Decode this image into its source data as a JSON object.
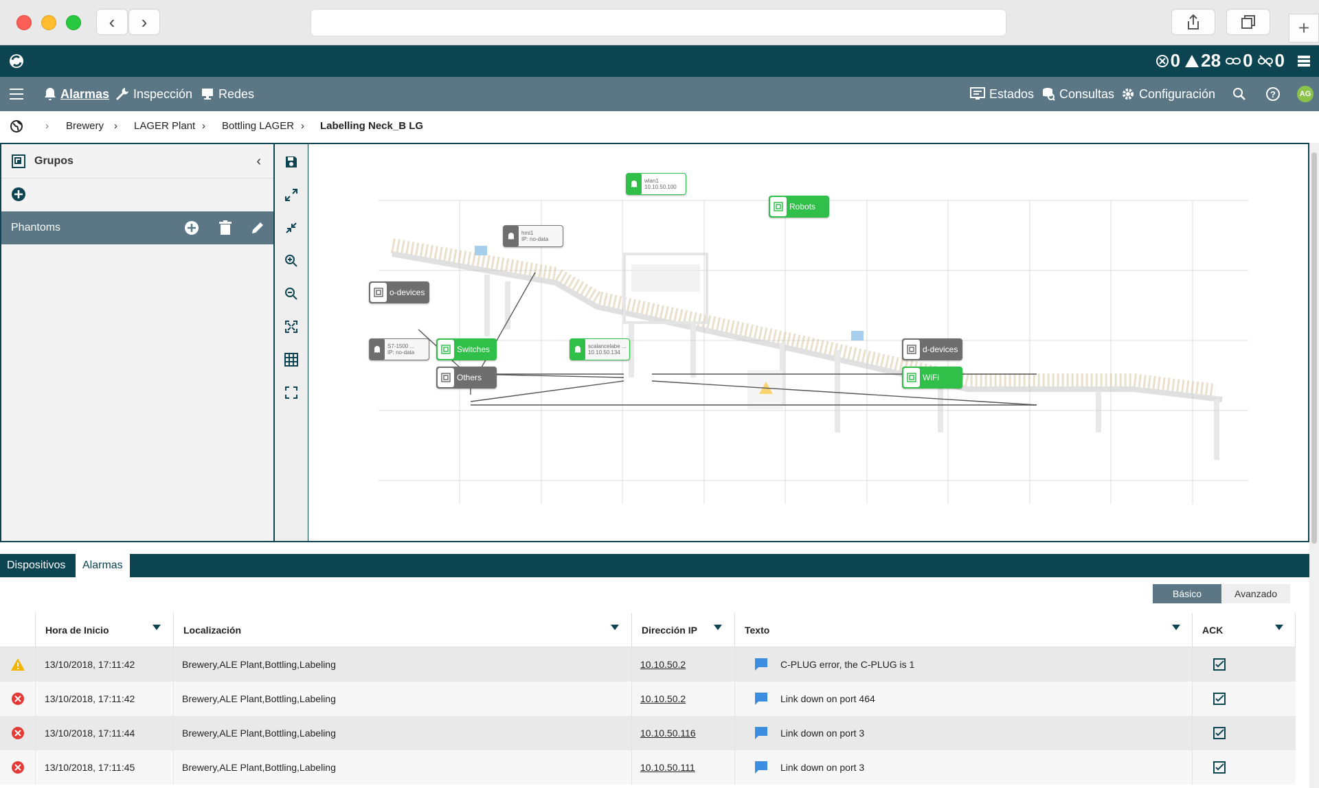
{
  "header": {
    "counters": [
      {
        "icon": "error-circle-icon",
        "value": "0"
      },
      {
        "icon": "warning-triangle-icon",
        "value": "28"
      },
      {
        "icon": "link-icon",
        "value": "0"
      },
      {
        "icon": "broken-link-icon",
        "value": "0"
      }
    ]
  },
  "nav": {
    "items": [
      {
        "label": "Alarmas",
        "icon": "bell-icon"
      },
      {
        "label": "Inspección",
        "icon": "wrench-icon"
      },
      {
        "label": "Redes",
        "icon": "monitor-icon"
      }
    ],
    "right": [
      {
        "label": "Estados",
        "icon": "status-screen-icon"
      },
      {
        "label": "Consultas",
        "icon": "query-icon"
      },
      {
        "label": "Configuración",
        "icon": "gear-icon"
      }
    ],
    "avatar": "AG"
  },
  "breadcrumb": [
    "Brewery",
    "LAGER Plant",
    "Bottling LAGER",
    "Labelling Neck_B LG"
  ],
  "sidebar": {
    "title": "Grupos",
    "group": "Phantoms"
  },
  "canvas": {
    "nodes": [
      {
        "id": "wlan1",
        "label": "wlan1",
        "sub": "10.10.50.100"
      },
      {
        "id": "robots",
        "label": "Robots"
      },
      {
        "id": "hmi1",
        "label": "hmi1",
        "sub": "IP: no-data"
      },
      {
        "id": "odev",
        "label": "o-devices"
      },
      {
        "id": "s7",
        "label": "S7-1500 ...",
        "sub": "IP: no-data"
      },
      {
        "id": "switches",
        "label": "Switches"
      },
      {
        "id": "scal",
        "label": "scalancelabe ...",
        "sub": "10.10.50.134"
      },
      {
        "id": "ddev",
        "label": "d-devices"
      },
      {
        "id": "others",
        "label": "Others"
      },
      {
        "id": "wifi",
        "label": "WiFi"
      }
    ]
  },
  "bottom": {
    "tabs": [
      "Dispositivos",
      "Alarmas"
    ],
    "modes": [
      "Básico",
      "Avanzado"
    ],
    "columns": [
      "Hora de Inicio",
      "Localización",
      "Dirección IP",
      "Texto",
      "ACK"
    ],
    "rows": [
      {
        "severity": "warning-icon",
        "time": "13/10/2018, 17:11:42",
        "loc": "Brewery,ALE Plant,Bottling,Labeling",
        "ip": "10.10.50.2",
        "text": "C-PLUG error, the C-PLUG is 1"
      },
      {
        "severity": "error-icon",
        "time": "13/10/2018, 17:11:42",
        "loc": "Brewery,ALE Plant,Bottling,Labeling",
        "ip": "10.10.50.2",
        "text": "Link down on port 464"
      },
      {
        "severity": "error-icon",
        "time": "13/10/2018, 17:11:44",
        "loc": "Brewery,ALE Plant,Bottling,Labeling",
        "ip": "10.10.50.116",
        "text": "Link down on port 3"
      },
      {
        "severity": "error-icon",
        "time": "13/10/2018, 17:11:45",
        "loc": "Brewery,ALE Plant,Bottling,Labeling",
        "ip": "10.10.50.111",
        "text": "Link down on port 3"
      }
    ]
  },
  "colors": {
    "brand": "#0c4451",
    "nav": "#5b7785",
    "green": "#30c04a",
    "error": "#e53935",
    "warning": "#f5b400"
  }
}
